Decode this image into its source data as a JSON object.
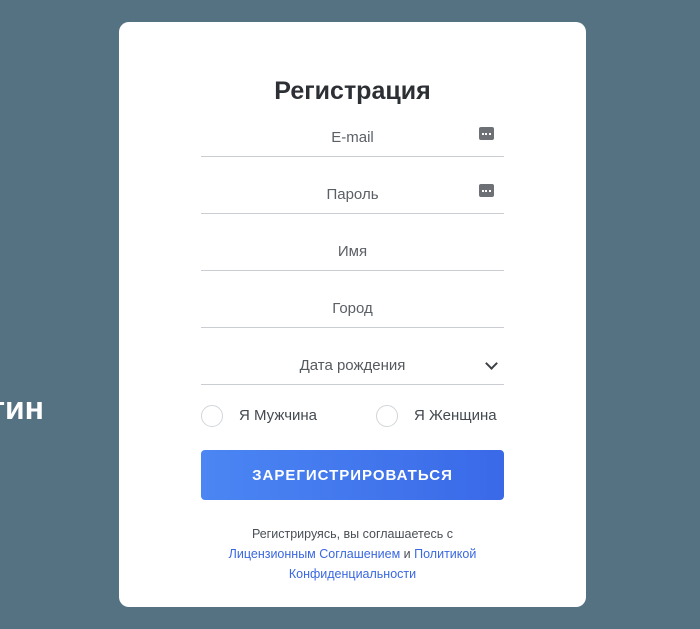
{
  "background_text": "Логин",
  "form": {
    "title": "Регистрация",
    "email_placeholder": "E-mail",
    "password_placeholder": "Пароль",
    "name_placeholder": "Имя",
    "city_placeholder": "Город",
    "birthdate_selected": "Дата рождения",
    "gender_options": [
      "Я Мужчина",
      "Я Женщина"
    ],
    "submit_label": "ЗАРЕГИСТРИРОВАТЬСЯ",
    "terms": {
      "prefix": "Регистрируясь, вы соглашаетесь с",
      "license_link": "Лицензионным Соглашением",
      "conjunction": "и",
      "privacy_link_1": "Политикой",
      "privacy_link_2": "Конфиденциальности"
    }
  },
  "colors": {
    "background": "#557283",
    "card": "#ffffff",
    "accent": "#3a69e8",
    "link": "#3a68e0"
  },
  "icons": {
    "email_field": "key-icon",
    "password_field": "key-icon",
    "birthdate_field": "chevron-down-icon"
  }
}
